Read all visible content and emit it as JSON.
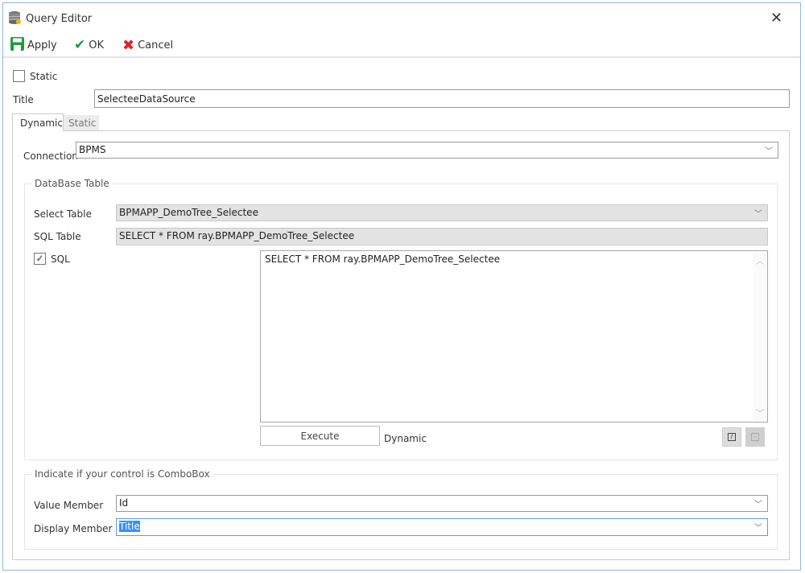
{
  "window": {
    "title": "Query Editor"
  },
  "toolbar": {
    "apply": "Apply",
    "ok": "OK",
    "cancel": "Cancel"
  },
  "static_checkbox": {
    "label": "Static",
    "checked": false
  },
  "title_field": {
    "label": "Title",
    "value": "SelecteeDataSource"
  },
  "tabs": [
    {
      "label": "Dynamic",
      "active": true
    },
    {
      "label": "Static",
      "active": false
    }
  ],
  "connection": {
    "label": "Connection",
    "value": "BPMS"
  },
  "database_group": {
    "legend": "DataBase Table",
    "select_table": {
      "label": "Select Table",
      "value": "BPMAPP_DemoTree_Selectee"
    },
    "sql_table": {
      "label": "SQL Table",
      "value": "SELECT * FROM ray.BPMAPP_DemoTree_Selectee"
    },
    "sql_checkbox": {
      "label": "SQL",
      "checked": true
    },
    "sql_text": "SELECT * FROM ray.BPMAPP_DemoTree_Selectee",
    "execute": "Execute",
    "mode": "Dynamic"
  },
  "combo_group": {
    "legend": "Indicate if your control is ComboBox",
    "value_member": {
      "label": "Value Member",
      "value": "Id"
    },
    "display_member": {
      "label": "Display Member",
      "value": "Title"
    }
  }
}
